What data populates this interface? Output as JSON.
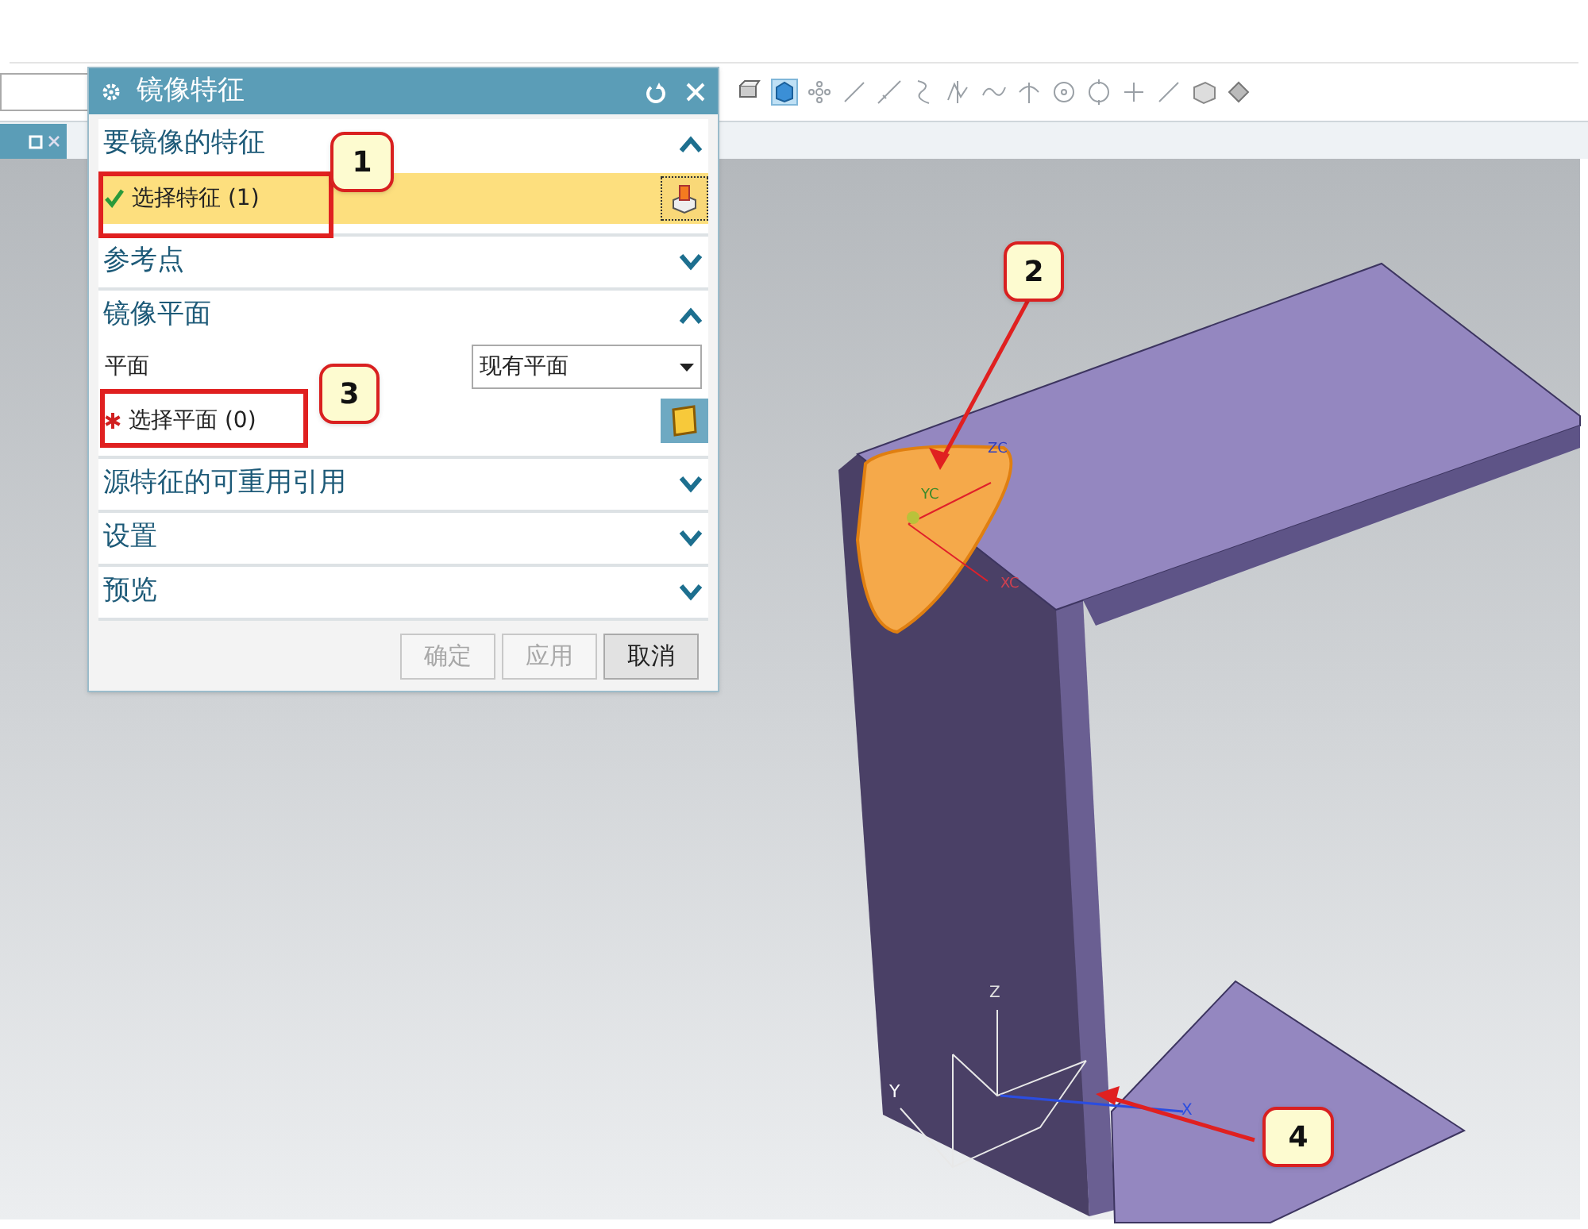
{
  "dialog": {
    "title": "镜像特征",
    "sections": [
      {
        "title": "要镜像的特征",
        "expanded": true,
        "items": [
          {
            "kind": "selection",
            "label": "选择特征 (1)",
            "done": true,
            "active": true
          }
        ]
      },
      {
        "title": "参考点",
        "expanded": false
      },
      {
        "title": "镜像平面",
        "expanded": true,
        "items": [
          {
            "kind": "dropdown",
            "label": "平面",
            "value": "现有平面"
          },
          {
            "kind": "selection",
            "label": "选择平面 (0)",
            "done": false,
            "active": false
          }
        ]
      },
      {
        "title": "源特征的可重用引用",
        "expanded": false
      },
      {
        "title": "设置",
        "expanded": false
      },
      {
        "title": "预览",
        "expanded": false
      }
    ],
    "buttons": [
      {
        "label": "确定",
        "disabled": true
      },
      {
        "label": "应用",
        "disabled": true
      },
      {
        "label": "取消",
        "disabled": false
      }
    ]
  },
  "callouts": [
    {
      "label": "1"
    },
    {
      "label": "2"
    },
    {
      "label": "3"
    },
    {
      "label": "4"
    }
  ],
  "viewport": {
    "work_triad_labels": [
      "ZC",
      "YC",
      "XC"
    ],
    "absolute_triad_labels": [
      "Z",
      "Y",
      "X"
    ]
  }
}
